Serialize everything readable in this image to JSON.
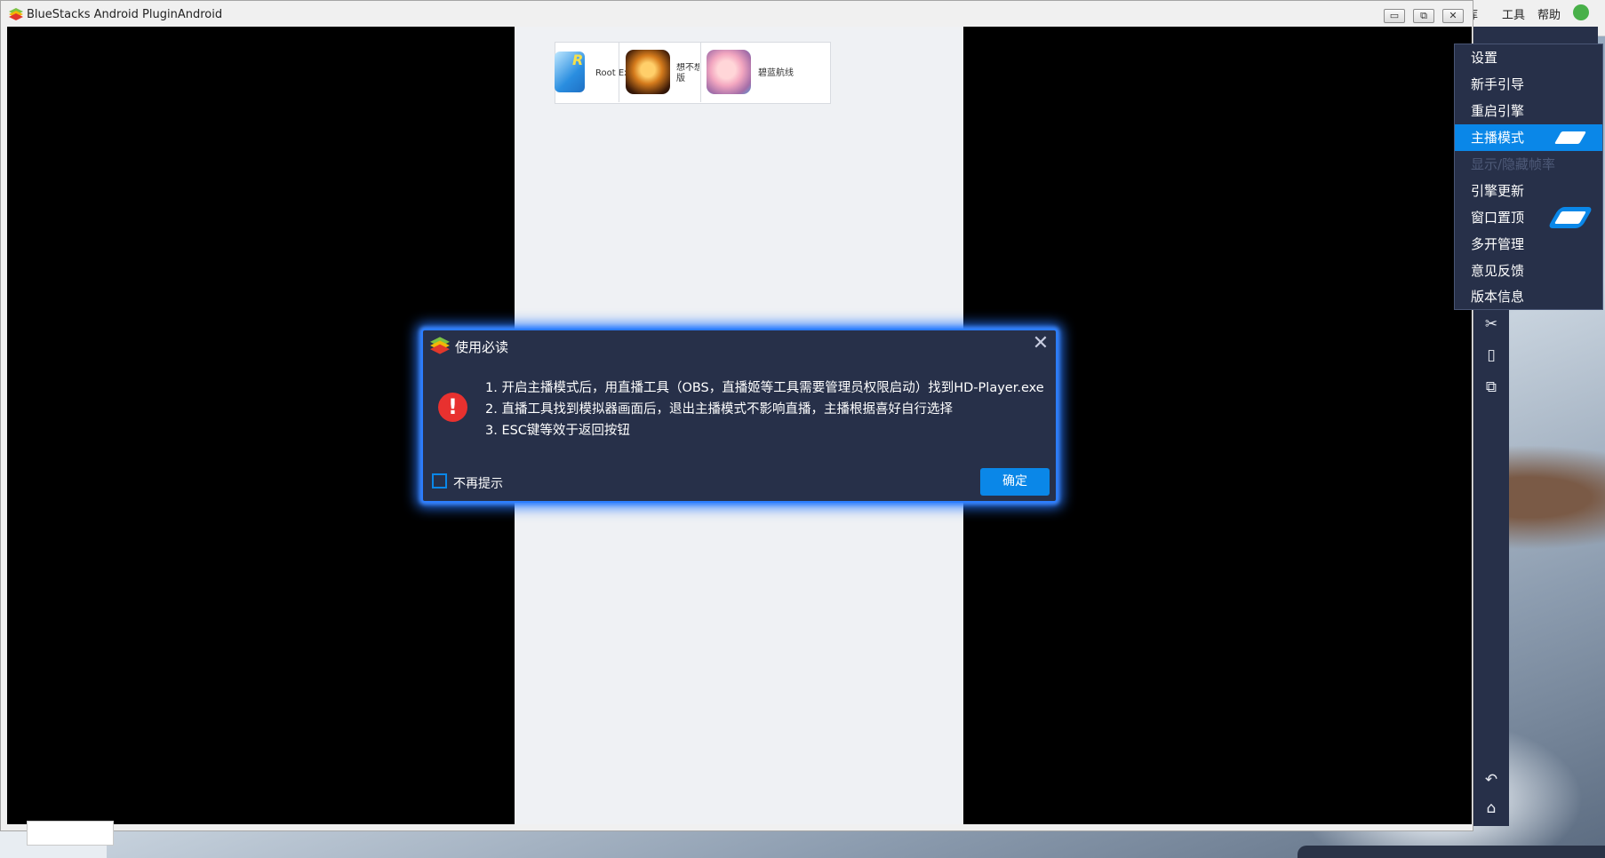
{
  "window": {
    "title": "BlueStacks Android PluginAndroid",
    "controls": {
      "minimize": "▭",
      "restore": "⧉",
      "close": "✕"
    }
  },
  "host_menu": {
    "items": [
      "库",
      "工具",
      "帮助"
    ]
  },
  "apps": [
    {
      "label": "Root Ex"
    },
    {
      "label": "想不想\n版"
    },
    {
      "label": "碧蓝航线"
    }
  ],
  "settings_menu": {
    "items": [
      {
        "label": "设置",
        "state": "normal"
      },
      {
        "label": "新手引导",
        "state": "normal"
      },
      {
        "label": "重启引擎",
        "state": "normal"
      },
      {
        "label": "主播模式",
        "state": "active",
        "toggle": "on"
      },
      {
        "label": "显示/隐藏帧率",
        "state": "disabled"
      },
      {
        "label": "引擎更新",
        "state": "normal"
      },
      {
        "label": "窗口置顶",
        "state": "normal",
        "toggle": "on"
      },
      {
        "label": "多开管理",
        "state": "normal"
      },
      {
        "label": "意见反馈",
        "state": "normal"
      },
      {
        "label": "版本信息",
        "state": "normal"
      }
    ]
  },
  "toolbar": {
    "icons": [
      "scissors-icon",
      "shake-icon",
      "multi-window-icon",
      "back-icon",
      "home-icon"
    ],
    "glyphs": [
      "✂",
      "▯",
      "⧉",
      "↶",
      "⌂"
    ]
  },
  "dialog": {
    "title": "使用必读",
    "lines": [
      "1. 开启主播模式后，用直播工具（OBS，直播姬等工具需要管理员权限启动）找到HD-Player.exe",
      "2. 直播工具找到模拟器画面后，退出主播模式不影响直播，主播根据喜好自行选择",
      "3. ESC键等效于返回按钮"
    ],
    "checkbox_label": "不再提示",
    "checkbox_checked": false,
    "ok_label": "确定",
    "close_glyph": "✕",
    "alert_glyph": "!"
  },
  "colors": {
    "accent": "#0a87e8",
    "panel": "#273049",
    "alert": "#e8312f"
  }
}
